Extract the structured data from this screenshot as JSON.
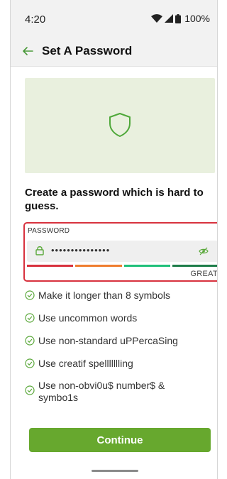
{
  "status_bar": {
    "time": "4:20",
    "battery": "100%"
  },
  "header": {
    "title": "Set A Password"
  },
  "headline": "Create a password which is hard to guess.",
  "password": {
    "label": "PASSWORD",
    "value": "•••••••••••••••",
    "strength_label": "GREAT",
    "strength_level": 1.0
  },
  "rules": [
    "Make it longer than 8 symbols",
    "Use uncommon words",
    "Use non-standard uPPercaSing",
    "Use creatif spellllllling",
    "Use non-obvi0u$ number$ & symbo1s"
  ],
  "continue_label": "Continue",
  "colors": {
    "accent": "#67a82e",
    "error_outline": "#d8323e",
    "hero_background": "#e9f0de",
    "meter": [
      "#d8323e",
      "#ef7d2f",
      "#20c07a",
      "#1e7d4a"
    ]
  },
  "icons": [
    "back-arrow-icon",
    "shield-icon",
    "lock-icon",
    "eye-off-icon",
    "check-circle-icon",
    "wifi-icon",
    "signal-icon",
    "battery-icon"
  ]
}
